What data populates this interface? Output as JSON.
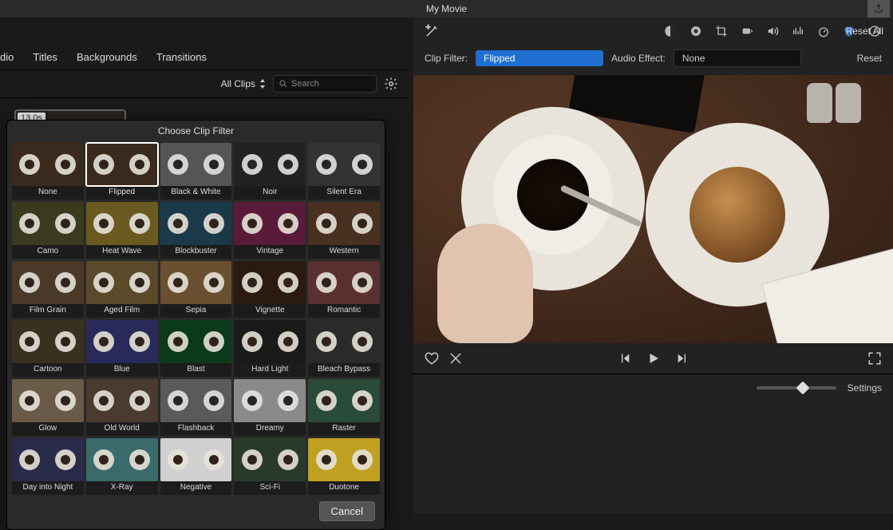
{
  "titlebar": {
    "title": "My Movie"
  },
  "tabs": [
    "dio",
    "Titles",
    "Backgrounds",
    "Transitions"
  ],
  "browser": {
    "allclips": "All Clips",
    "search_placeholder": "Search",
    "clip_duration": "13.0s"
  },
  "adjust": {
    "reset_all": "Reset All",
    "clip_filter_label": "Clip Filter:",
    "clip_filter_value": "Flipped",
    "audio_effect_label": "Audio Effect:",
    "audio_effect_value": "None",
    "reset": "Reset",
    "settings": "Settings"
  },
  "chooser": {
    "title": "Choose Clip Filter",
    "cancel": "Cancel",
    "selected": "Flipped",
    "filters": [
      {
        "name": "None",
        "tint": "#3a2a1e"
      },
      {
        "name": "Flipped",
        "tint": "#3a2a1e"
      },
      {
        "name": "Black & White",
        "tint": "#555",
        "mono": true
      },
      {
        "name": "Noir",
        "tint": "#222",
        "mono": true
      },
      {
        "name": "Silent Era",
        "tint": "#333",
        "mono": true
      },
      {
        "name": "Camo",
        "tint": "#3a3a1e"
      },
      {
        "name": "Heat Wave",
        "tint": "#6a5a20"
      },
      {
        "name": "Blockbuster",
        "tint": "#1a3a4a"
      },
      {
        "name": "Vintage",
        "tint": "#5a1a3a"
      },
      {
        "name": "Western",
        "tint": "#4a3020"
      },
      {
        "name": "Film Grain",
        "tint": "#4a3828"
      },
      {
        "name": "Aged Film",
        "tint": "#5a4a2a"
      },
      {
        "name": "Sepia",
        "tint": "#6a5030"
      },
      {
        "name": "Vignette",
        "tint": "#2a1a10"
      },
      {
        "name": "Romantic",
        "tint": "#5a3030"
      },
      {
        "name": "Cartoon",
        "tint": "#3a3020"
      },
      {
        "name": "Blue",
        "tint": "#2a2a5a"
      },
      {
        "name": "Blast",
        "tint": "#0a3a1a"
      },
      {
        "name": "Hard Light",
        "tint": "#1a1a1a"
      },
      {
        "name": "Bleach Bypass",
        "tint": "#2a2a2a"
      },
      {
        "name": "Glow",
        "tint": "#6a5a48"
      },
      {
        "name": "Old World",
        "tint": "#4a3a30"
      },
      {
        "name": "Flashback",
        "tint": "#5a5a5a",
        "mono": true
      },
      {
        "name": "Dreamy",
        "tint": "#8a8a8a",
        "mono": true
      },
      {
        "name": "Raster",
        "tint": "#2a4a3a"
      },
      {
        "name": "Day into Night",
        "tint": "#2a2a4a"
      },
      {
        "name": "X-Ray",
        "tint": "#3a6a6a"
      },
      {
        "name": "Negative",
        "tint": "#d0d0d0"
      },
      {
        "name": "Sci-Fi",
        "tint": "#2a3a2a"
      },
      {
        "name": "Duotone",
        "tint": "#c0a020"
      }
    ]
  }
}
